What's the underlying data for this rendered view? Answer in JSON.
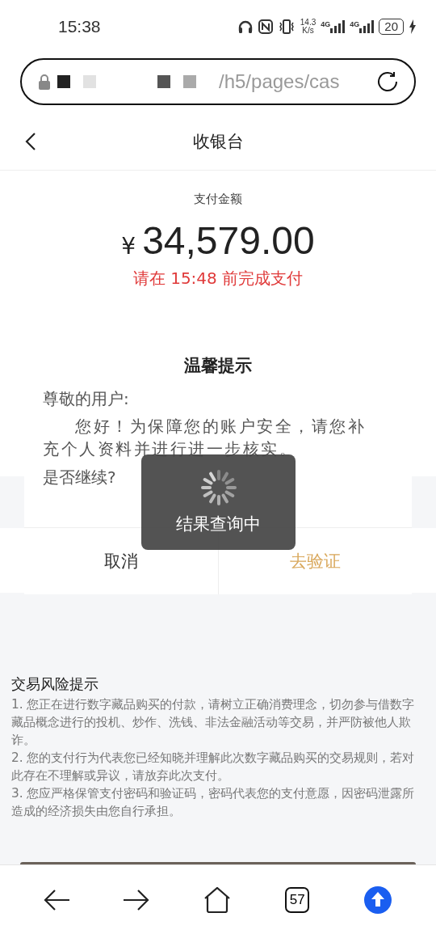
{
  "status_bar": {
    "time": "15:38",
    "speed_value": "14.3",
    "speed_unit": "K/s",
    "sim_1": "4G",
    "sim_2": "4G",
    "battery": "20"
  },
  "address_bar": {
    "url": "/h5/pages/cas"
  },
  "header": {
    "title": "收银台"
  },
  "payment": {
    "label": "支付金额",
    "currency": "¥",
    "amount": "34,579.00",
    "deadline": "请在 15:48 前完成支付"
  },
  "dialog": {
    "title": "温馨提示",
    "greeting": "尊敬的用户:",
    "message": "您好！为保障您的账户安全，请您补充个人资料并进行进一步核实。",
    "question": "是否继续?",
    "buttons": [
      {
        "label": "取消",
        "kind": "cancel"
      },
      {
        "label": "去验证",
        "kind": "confirm"
      }
    ]
  },
  "toast": {
    "text": "结果查询中"
  },
  "risk_notice": {
    "title": "交易风险提示",
    "items": [
      "1. 您正在进行数字藏品购买的付款，请树立正确消费理念，切勿参与借数字藏品概念进行的投机、炒作、洗钱、非法金融活动等交易，并严防被他人欺诈。",
      "2. 您的支付行为代表您已经知晓并理解此次数字藏品购买的交易规则，若对此存在不理解或异议，请放弃此次支付。",
      "3. 您应严格保管支付密码和验证码，密码代表您的支付意愿，因密码泄露所造成的经济损失由您自行承担。"
    ]
  },
  "bottom_nav": {
    "tab_count": "57"
  }
}
